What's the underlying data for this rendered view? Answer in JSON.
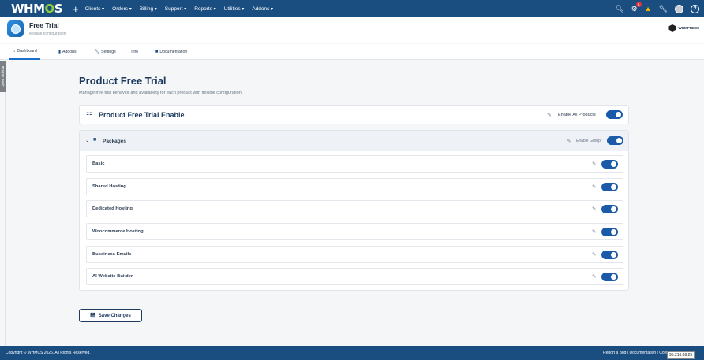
{
  "topnav": {
    "logo_text_1": "WHM",
    "logo_text_2": "C",
    "logo_text_3": "S",
    "menu": [
      "Clients",
      "Orders",
      "Billing",
      "Support",
      "Reports",
      "Utilities",
      "Addons"
    ],
    "notification_count": "1",
    "help_label": "?"
  },
  "header": {
    "title": "Free Trial",
    "subtitle": "Module configuration",
    "brand": "WHMPRESS"
  },
  "tabs": [
    {
      "label": "Dashboard",
      "icon": "home-icon"
    },
    {
      "label": "Addons",
      "icon": "addons-icon"
    },
    {
      "label": "Settings",
      "icon": "wrench-icon"
    },
    {
      "label": "Info",
      "icon": "info-icon"
    },
    {
      "label": "Documentation",
      "icon": "folder-icon"
    }
  ],
  "sidebar_toggle": "Open Sidebar",
  "main": {
    "title": "Product Free Trial",
    "description": "Manage free trial behavior and availability for each product with flexible configuration.",
    "enable_card": {
      "title": "Product Free Trial Enable",
      "toggle_label": "Enable All Products",
      "enabled": true
    },
    "group": {
      "title": "Packages",
      "toggle_label": "Enable Group",
      "enabled": true,
      "packages": [
        {
          "name": "Basic",
          "enabled": true
        },
        {
          "name": "Shared Hosting",
          "enabled": true
        },
        {
          "name": "Dedicated Hosting",
          "enabled": true
        },
        {
          "name": "Woocommerce Hosting",
          "enabled": true
        },
        {
          "name": "Bussiness Emails",
          "enabled": true
        },
        {
          "name": "AI Website Builder",
          "enabled": true
        }
      ]
    },
    "save_label": "Save Changes"
  },
  "footer": {
    "copyright": "Copyright © WHMCS 2026. All Rights Reserved.",
    "links": "Report a Bug | Documentation | Contact Us"
  },
  "ip_badge": "95.216.88.25",
  "colors": {
    "nav": "#1a4d80",
    "accent": "#1a5aa8",
    "logo_accent": "#8ccf3a"
  }
}
